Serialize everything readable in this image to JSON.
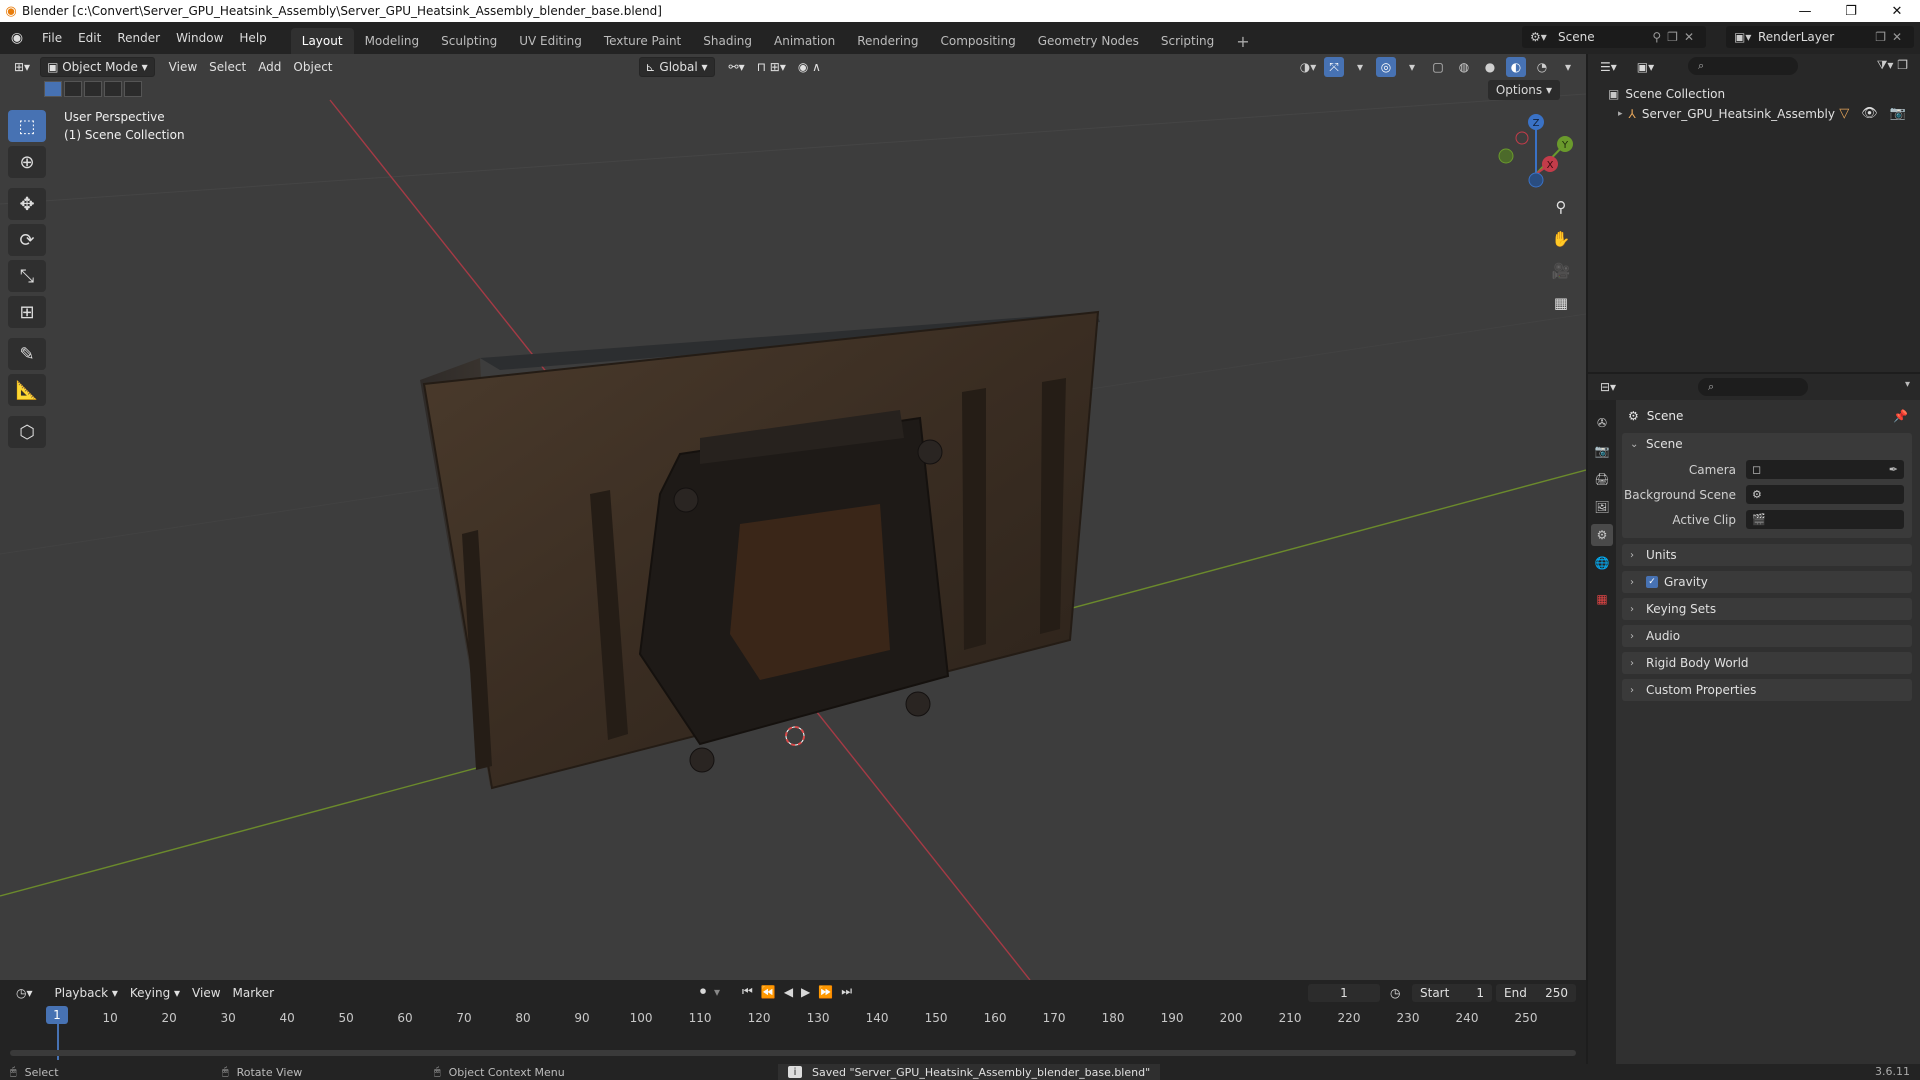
{
  "window": {
    "title": "Blender [c:\\Convert\\Server_GPU_Heatsink_Assembly\\Server_GPU_Heatsink_Assembly_blender_base.blend]",
    "minimize": "—",
    "maximize": "❐",
    "close": "✕"
  },
  "menubar": {
    "items": [
      "File",
      "Edit",
      "Render",
      "Window",
      "Help"
    ]
  },
  "workspaces": {
    "tabs": [
      "Layout",
      "Modeling",
      "Sculpting",
      "UV Editing",
      "Texture Paint",
      "Shading",
      "Animation",
      "Rendering",
      "Compositing",
      "Geometry Nodes",
      "Scripting"
    ],
    "active": "Layout",
    "add": "+"
  },
  "scene_selector": {
    "value": "Scene"
  },
  "viewlayer_selector": {
    "value": "RenderLayer"
  },
  "viewport": {
    "mode": "Object Mode",
    "menus": [
      "View",
      "Select",
      "Add",
      "Object"
    ],
    "transform_orientation": "Global",
    "options_label": "Options",
    "overlay_line1": "User Perspective",
    "overlay_line2": "(1) Scene Collection",
    "gizmo": {
      "x": "X",
      "y": "Y",
      "z": "Z"
    }
  },
  "outliner": {
    "search_placeholder": "⌕",
    "root": "Scene Collection",
    "child": "Server_GPU_Heatsink_Assembly"
  },
  "properties": {
    "search_placeholder": "⌕",
    "context_title": "Scene",
    "scene_panel": {
      "title": "Scene",
      "rows": [
        {
          "label": "Camera",
          "value": ""
        },
        {
          "label": "Background Scene",
          "value": ""
        },
        {
          "label": "Active Clip",
          "value": ""
        }
      ]
    },
    "panels": [
      "Units",
      "Gravity",
      "Keying Sets",
      "Audio",
      "Rigid Body World",
      "Custom Properties"
    ],
    "gravity_checked": true
  },
  "timeline": {
    "menus": [
      "Playback",
      "Keying",
      "View",
      "Marker"
    ],
    "current_frame": "1",
    "start_label": "Start",
    "start_value": "1",
    "end_label": "End",
    "end_value": "250",
    "ticks": [
      "1",
      "10",
      "20",
      "30",
      "40",
      "50",
      "60",
      "70",
      "80",
      "90",
      "100",
      "110",
      "120",
      "130",
      "140",
      "150",
      "160",
      "170",
      "180",
      "190",
      "200",
      "210",
      "220",
      "230",
      "240",
      "250"
    ]
  },
  "statusbar": {
    "select": "Select",
    "rotate": "Rotate View",
    "context": "Object Context Menu",
    "message": "Saved \"Server_GPU_Heatsink_Assembly_blender_base.blend\"",
    "version": "3.6.11"
  }
}
